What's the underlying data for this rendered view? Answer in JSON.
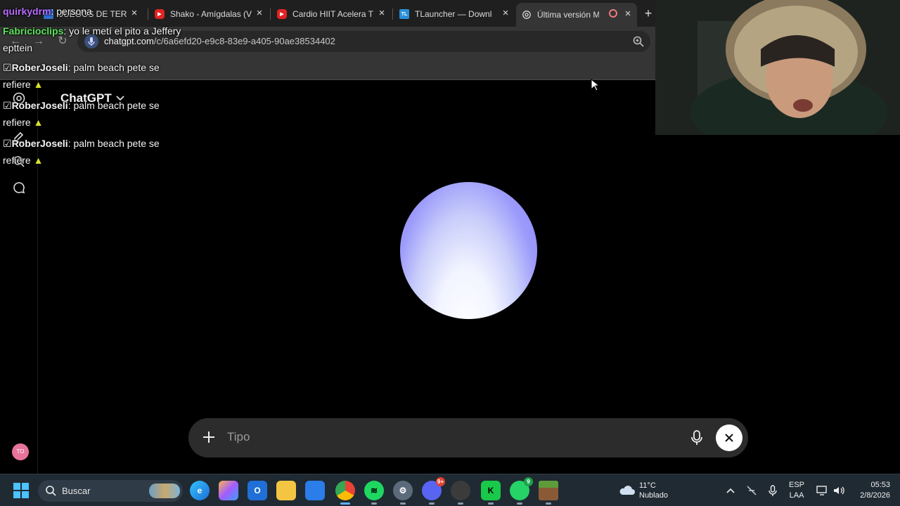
{
  "browser": {
    "tabs": [
      {
        "title": "JUEGOS DE TER",
        "icon": "tab-favicon-blue"
      },
      {
        "title": "Shako - Amígdalas (V",
        "icon": "youtube-icon"
      },
      {
        "title": "Cardio HIIT Acelera T",
        "icon": "youtube-icon"
      },
      {
        "title": "TLauncher — Downlo",
        "icon": "tlauncher-icon",
        "icon_text": "TL"
      },
      {
        "title": "Última versión Mi",
        "icon": "chatgpt-icon",
        "active": true
      }
    ],
    "url_host": "chatgpt.com",
    "url_path": "/c/6a6efd20-e9c8-83e9-a405-90ae38534402"
  },
  "chatgpt": {
    "model_name": "ChatGPT",
    "composer_placeholder": "Tipo",
    "avatar_initials": "TO",
    "orb_colors": {
      "top": "#8a84f7",
      "bottom": "#ffffff"
    }
  },
  "stream_chat": {
    "messages": [
      {
        "user": "quirkydrm",
        "text": ": persona",
        "color": "#b86bff"
      },
      {
        "user": "Fabricioclips",
        "text": ": yo le metí el pito a Jeffery",
        "continuation": "epttein",
        "color": "#5ce35c"
      },
      {
        "user": "RoberJoseli",
        "text": ": palm beach pete se",
        "continuation": "refiere",
        "color": "#dddddd"
      },
      {
        "user": "RoberJoseli",
        "text": ": palm beach pete se",
        "continuation": "refiere",
        "color": "#dddddd"
      },
      {
        "user": "RoberJoseli",
        "text": ": palm beach pete se",
        "continuation": "refiere",
        "color": "#dddddd"
      }
    ]
  },
  "taskbar": {
    "search_label": "Buscar",
    "weather": {
      "temp": "11°C",
      "condition": "Nublado"
    },
    "language": {
      "line1": "ESP",
      "line2": "LAA"
    },
    "clock": {
      "time": "05:53",
      "date": "2/8/2026"
    },
    "badges": {
      "discord": "9+",
      "whatsapp": "9"
    }
  }
}
